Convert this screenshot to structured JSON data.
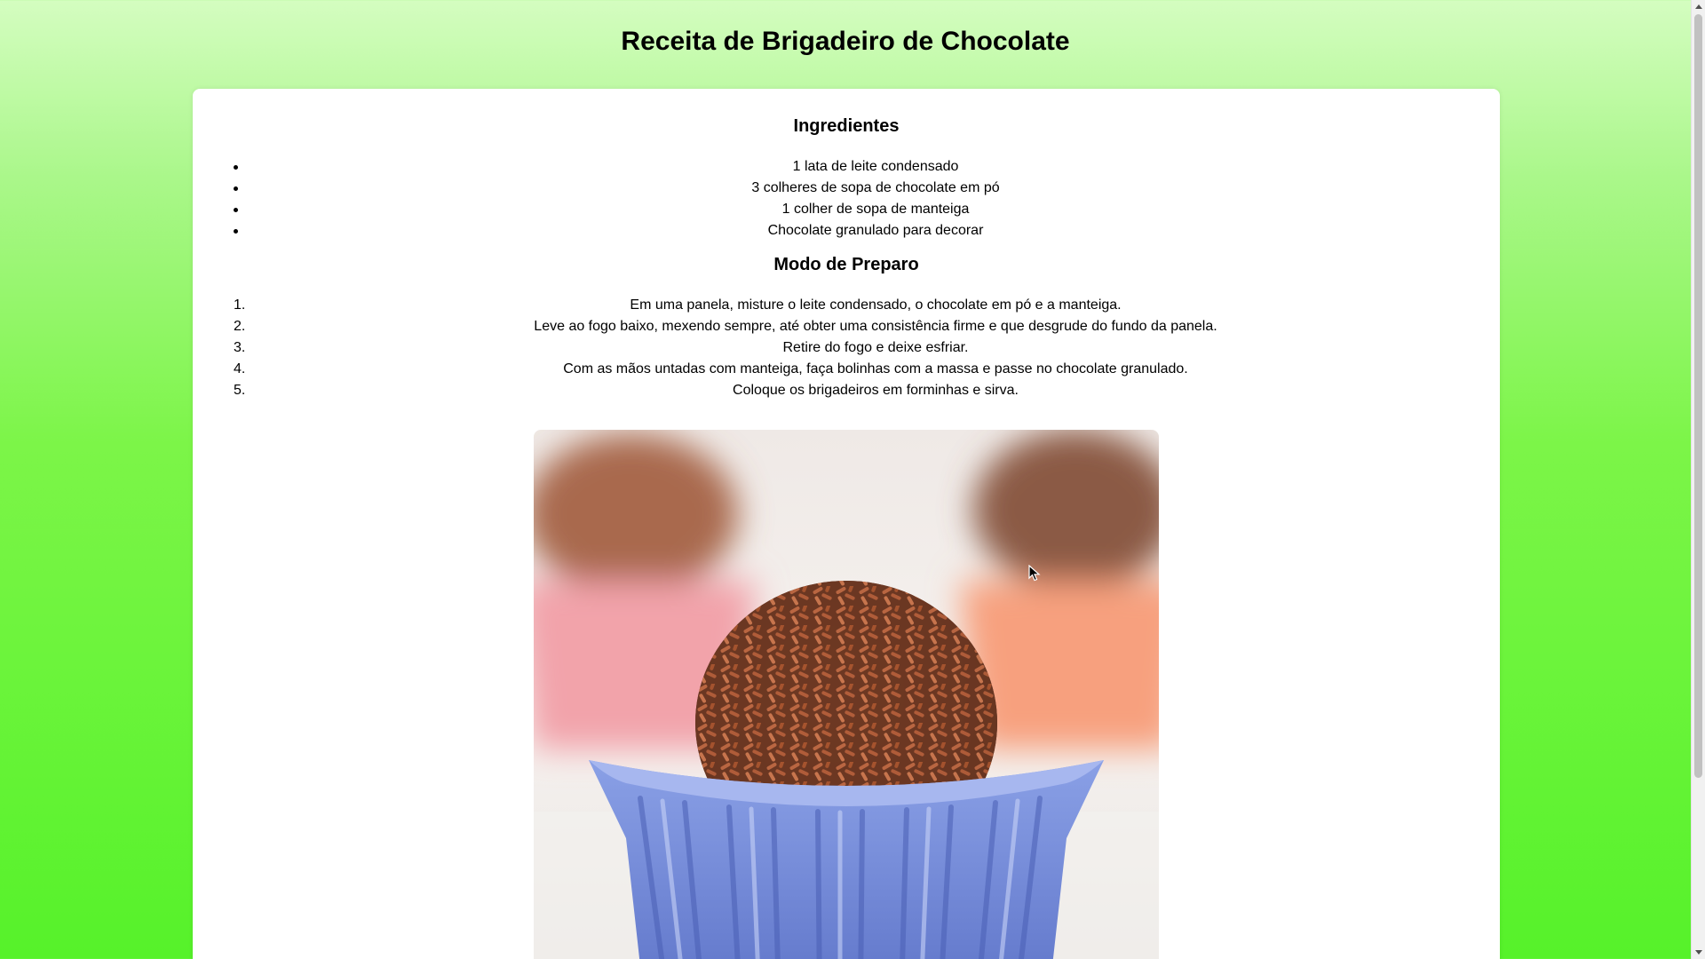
{
  "page": {
    "title": "Receita de Brigadeiro de Chocolate"
  },
  "ingredients": {
    "heading": "Ingredientes",
    "items": [
      "1 lata de leite condensado",
      "3 colheres de sopa de chocolate em pó",
      "1 colher de sopa de manteiga",
      "Chocolate granulado para decorar"
    ]
  },
  "preparation": {
    "heading": "Modo de Preparo",
    "steps": [
      {
        "number": "1.",
        "text": "Em uma panela, misture o leite condensado, o chocolate em pó e a manteiga."
      },
      {
        "number": "2.",
        "text": "Leve ao fogo baixo, mexendo sempre, até obter uma consistência firme e que desgrude do fundo da panela."
      },
      {
        "number": "3.",
        "text": "Retire do fogo e deixe esfriar."
      },
      {
        "number": "4.",
        "text": "Com as mãos untadas com manteiga, faça bolinhas com a massa e passe no chocolate granulado."
      },
      {
        "number": "5.",
        "text": "Coloque os brigadeiros em forminhas e sirva."
      }
    ]
  },
  "colors": {
    "background_top": "#d4fdc0",
    "background_bottom": "#56f22a",
    "card": "#ffffff",
    "text": "#000000"
  },
  "icons": {
    "cursor": "mouse-pointer-icon",
    "scroll_up": "scroll-up-arrow-icon",
    "scroll_down": "scroll-down-arrow-icon"
  }
}
